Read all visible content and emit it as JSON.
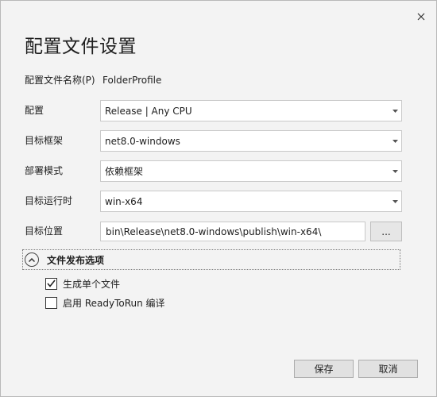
{
  "dialog": {
    "title": "配置文件设置",
    "close_icon": "close-icon"
  },
  "form": {
    "profile_name": {
      "label": "配置文件名称(P)",
      "value": "FolderProfile"
    },
    "configuration": {
      "label": "配置",
      "value": "Release | Any CPU"
    },
    "target_framework": {
      "label": "目标框架",
      "value": "net8.0-windows"
    },
    "deployment_mode": {
      "label": "部署模式",
      "value": "依赖框架"
    },
    "target_runtime": {
      "label": "目标运行时",
      "value": "win-x64"
    },
    "target_location": {
      "label": "目标位置",
      "value": "bin\\Release\\net8.0-windows\\publish\\win-x64\\",
      "browse_label": "..."
    }
  },
  "publish_options": {
    "title": "文件发布选项",
    "options": [
      {
        "label": "生成单个文件",
        "checked": true
      },
      {
        "label": "启用 ReadyToRun 编译",
        "checked": false
      }
    ]
  },
  "footer": {
    "save_label": "保存",
    "cancel_label": "取消"
  }
}
